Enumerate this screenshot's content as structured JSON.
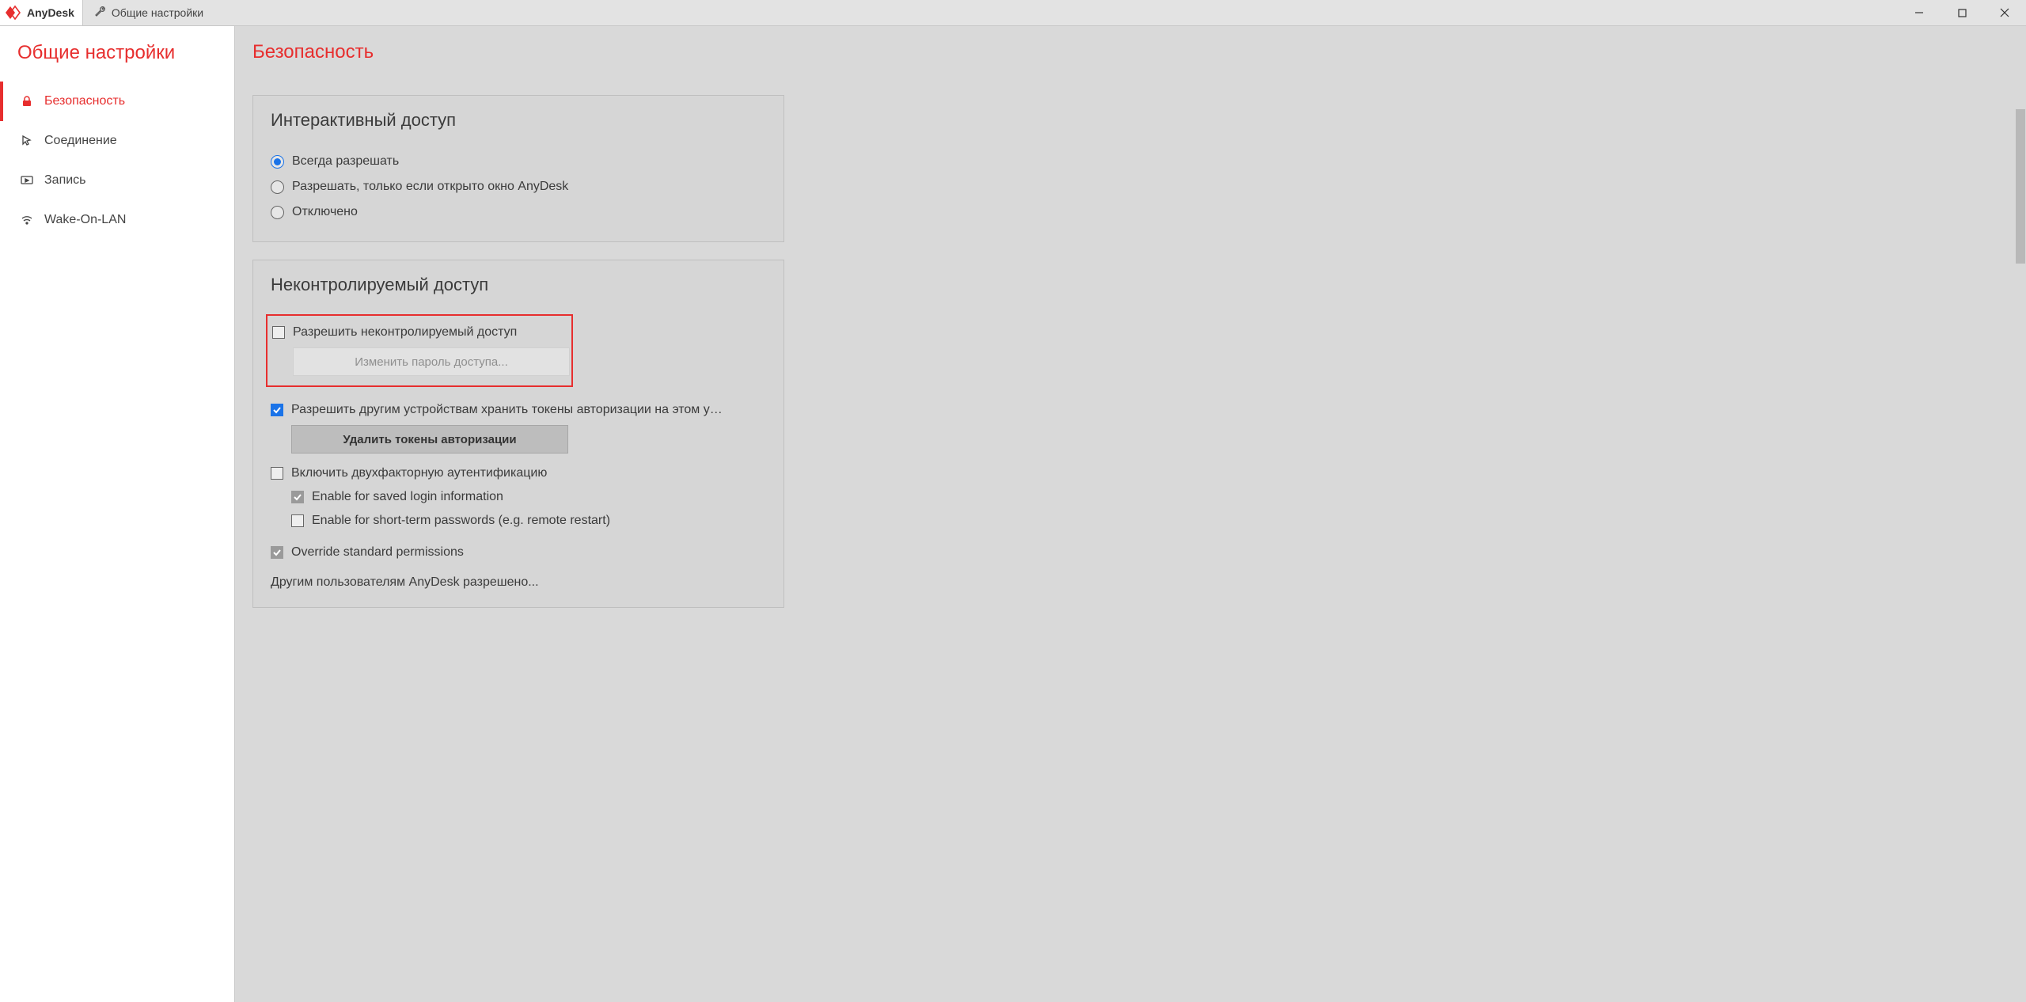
{
  "titlebar": {
    "app_name": "AnyDesk",
    "tab_label": "Общие настройки"
  },
  "sidebar": {
    "title": "Общие настройки",
    "items": [
      {
        "label": "Безопасность",
        "active": true,
        "icon": "lock"
      },
      {
        "label": "Соединение",
        "active": false,
        "icon": "cursor"
      },
      {
        "label": "Запись",
        "active": false,
        "icon": "play-screen"
      },
      {
        "label": "Wake-On-LAN",
        "active": false,
        "icon": "wifi"
      }
    ]
  },
  "main": {
    "header_title": "Безопасность",
    "section_interactive": {
      "title": "Интерактивный доступ",
      "options": [
        {
          "label": "Всегда разрешать",
          "selected": true
        },
        {
          "label": "Разрешать, только если открыто окно AnyDesk",
          "selected": false
        },
        {
          "label": "Отключено",
          "selected": false
        }
      ]
    },
    "section_unattended": {
      "title": "Неконтролируемый доступ",
      "allow_unattended": {
        "label": "Разрешить неконтролируемый доступ",
        "checked": false
      },
      "change_password_btn": "Изменить пароль доступа...",
      "allow_tokens": {
        "label": "Разрешить другим устройствам хранить токены авторизации на этом у…",
        "checked": true
      },
      "delete_tokens_btn": "Удалить токены авторизации",
      "enable_2fa": {
        "label": "Включить двухфакторную аутентификацию",
        "checked": false
      },
      "enable_saved_login": {
        "label": "Enable for saved login information",
        "checked": true
      },
      "enable_short_term": {
        "label": "Enable for short-term passwords (e.g. remote restart)",
        "checked": false
      },
      "override_permissions": {
        "label": "Override standard permissions",
        "checked": true
      },
      "footer_text": "Другим пользователям AnyDesk разрешено..."
    }
  }
}
